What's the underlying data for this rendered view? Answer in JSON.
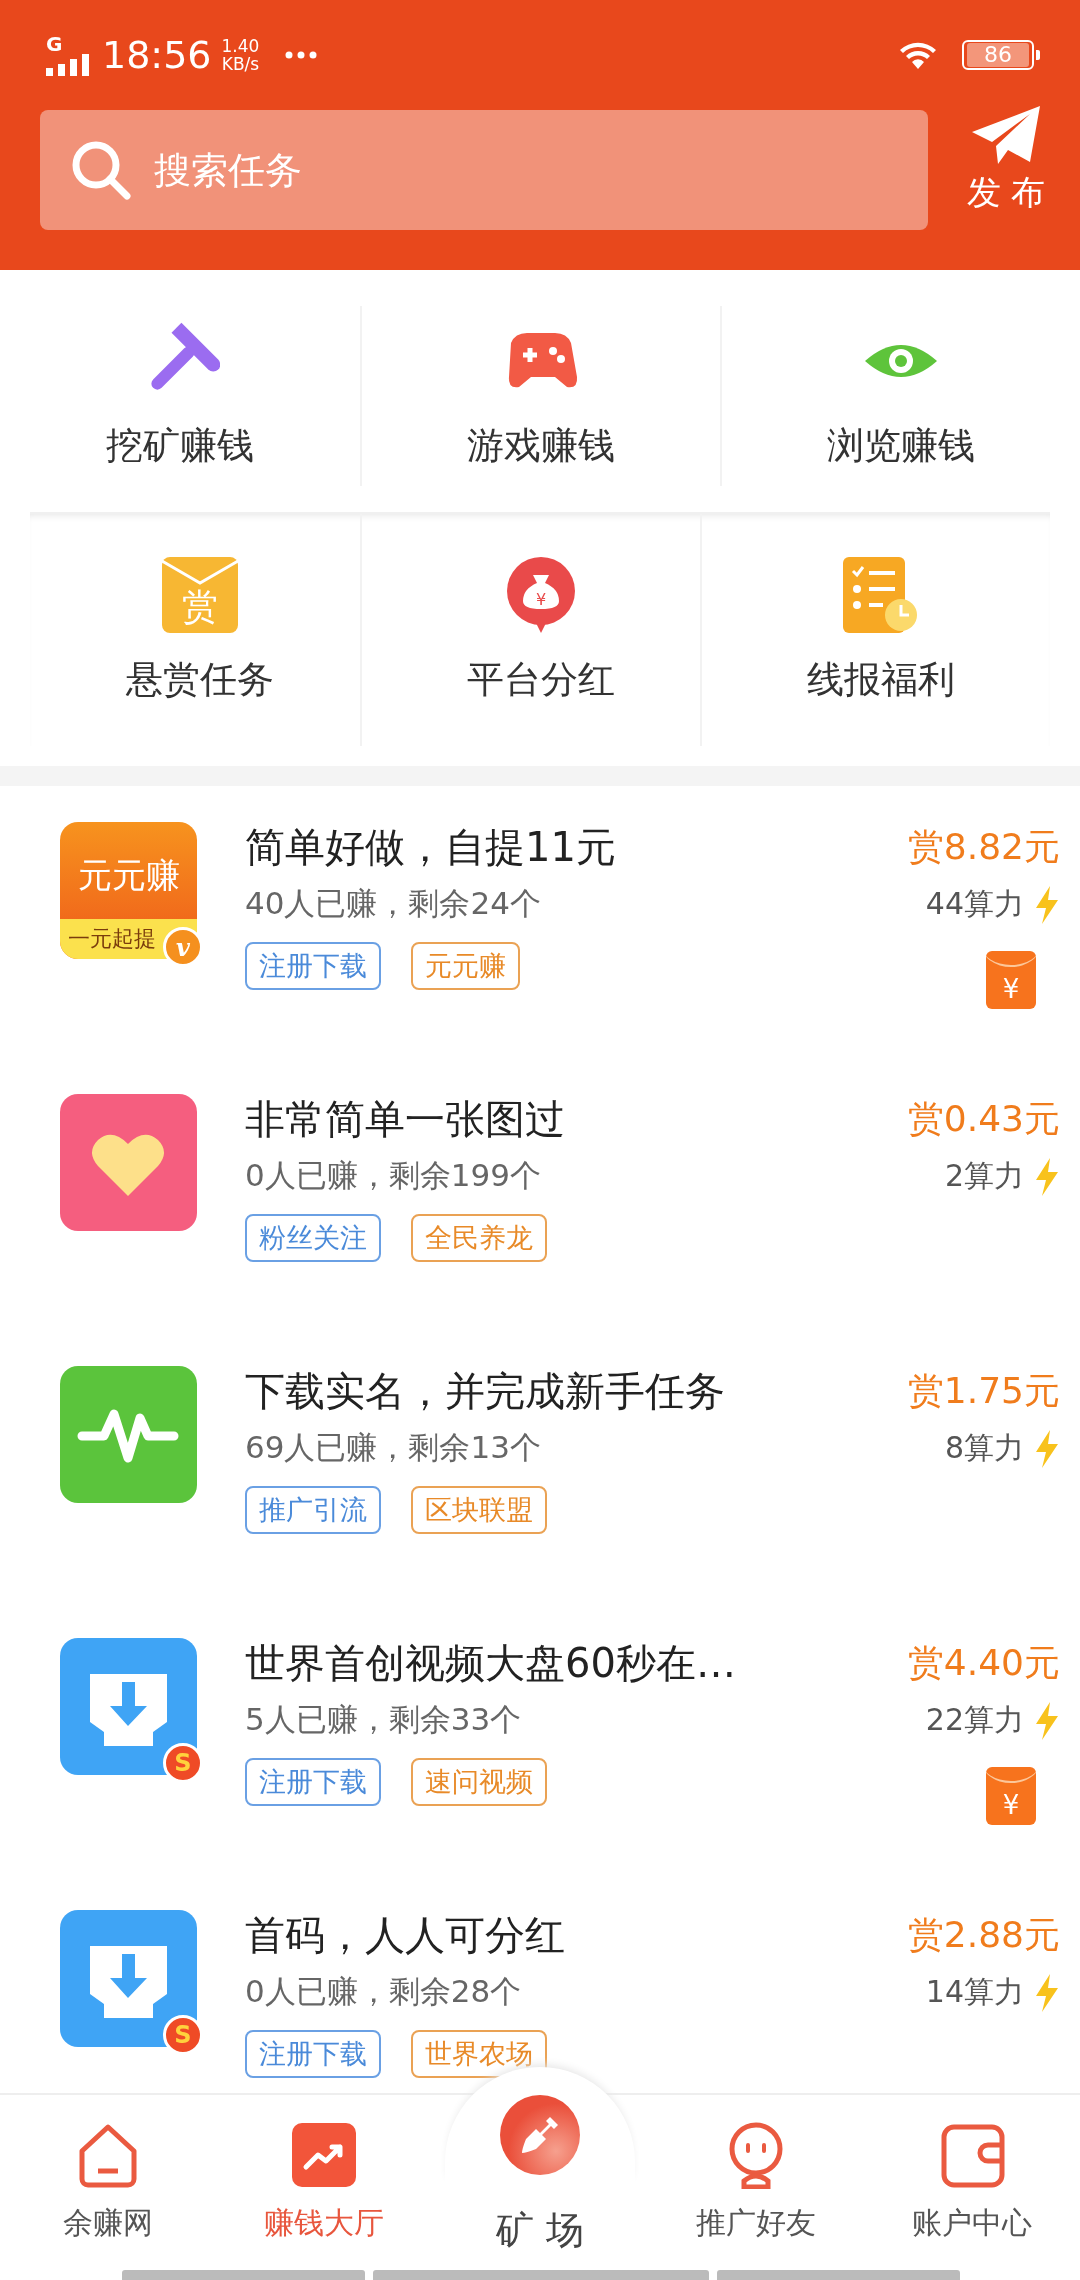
{
  "status_bar": {
    "network": "G",
    "time": "18:56",
    "speed": "1.40",
    "speed_unit": "KB/s",
    "battery": "86"
  },
  "search": {
    "placeholder": "搜索任务"
  },
  "publish_button": {
    "label": "发 布"
  },
  "categories": [
    {
      "label": "挖矿赚钱",
      "kind": "pickaxe"
    },
    {
      "label": "游戏赚钱",
      "kind": "gamepad"
    },
    {
      "label": "浏览赚钱",
      "kind": "eye"
    },
    {
      "label": "悬赏任务",
      "kind": "envelope",
      "icon_text": "赏"
    },
    {
      "label": "平台分红",
      "kind": "moneybag",
      "icon_text": "¥"
    },
    {
      "label": "线报福利",
      "kind": "checklist"
    }
  ],
  "tasks": [
    {
      "title": "简单好做，自提11元",
      "stats": "40人已赚，剩余24个",
      "reward": "赏8.82元",
      "power": "44算力",
      "icon": {
        "kind": "yuan",
        "text": "元元赚",
        "subtext": "一元起提",
        "badge": "v"
      },
      "tags": [
        {
          "label": "注册下载",
          "kind": "type"
        },
        {
          "label": "元元赚",
          "kind": "source"
        }
      ],
      "red_packet": "¥"
    },
    {
      "title": "非常简单一张图过",
      "stats": "0人已赚，剩余199个",
      "reward": "赏0.43元",
      "power": "2算力",
      "icon": {
        "kind": "heart"
      },
      "tags": [
        {
          "label": "粉丝关注",
          "kind": "type"
        },
        {
          "label": "全民养龙",
          "kind": "source"
        }
      ]
    },
    {
      "title": "下载实名，并完成新手任务",
      "stats": "69人已赚，剩余13个",
      "reward": "赏1.75元",
      "power": "8算力",
      "icon": {
        "kind": "pulse"
      },
      "tags": [
        {
          "label": "推广引流",
          "kind": "type"
        },
        {
          "label": "区块联盟",
          "kind": "source"
        }
      ]
    },
    {
      "title": "世界首创视频大盘60秒在…",
      "stats": "5人已赚，剩余33个",
      "reward": "赏4.40元",
      "power": "22算力",
      "icon": {
        "kind": "download",
        "badge": "S"
      },
      "tags": [
        {
          "label": "注册下载",
          "kind": "type"
        },
        {
          "label": "速问视频",
          "kind": "source"
        }
      ],
      "red_packet": "¥"
    },
    {
      "title": "首码，人人可分红",
      "stats": "0人已赚，剩余28个",
      "reward": "赏2.88元",
      "power": "14算力",
      "icon": {
        "kind": "download",
        "badge": "S"
      },
      "tags": [
        {
          "label": "注册下载",
          "kind": "type"
        },
        {
          "label": "世界农场",
          "kind": "source"
        }
      ]
    }
  ],
  "nav": [
    {
      "label": "余赚网",
      "kind": "home",
      "selected": false
    },
    {
      "label": "赚钱大厅",
      "kind": "trend",
      "selected": true
    },
    {
      "label": "矿 场",
      "kind": "shovel",
      "selected": false
    },
    {
      "label": "推广好友",
      "kind": "person",
      "selected": false
    },
    {
      "label": "账户中心",
      "kind": "wallet",
      "selected": false
    }
  ]
}
